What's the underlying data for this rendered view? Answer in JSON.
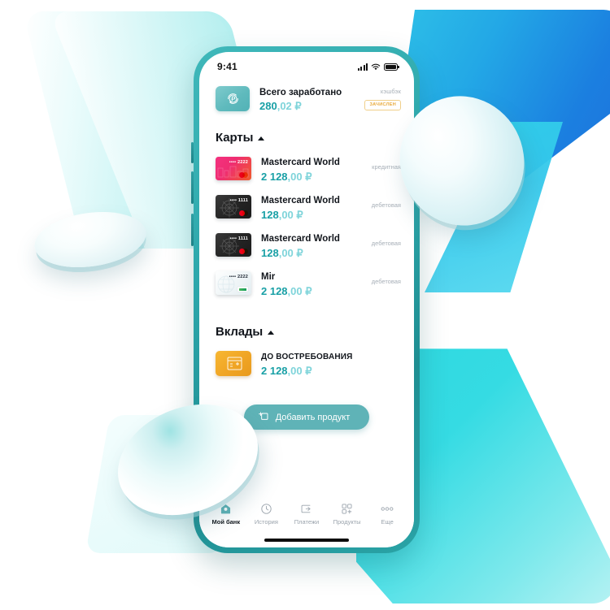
{
  "phone": {
    "status_bar": {
      "time": "9:41",
      "icons": [
        "signal-icon",
        "wifi-icon",
        "battery-icon"
      ]
    },
    "cashback": {
      "icon": "cashback-ruble-icon",
      "title": "Всего заработано",
      "amount_int": "280",
      "amount_dec": ",02",
      "currency": "₽",
      "label": "кэшбэк",
      "badge": "ЗАЧИСЛЕН"
    },
    "sections": [
      {
        "id": "cards",
        "title": "Карты",
        "collapse_icon": "caret-up-icon",
        "items": [
          {
            "art": "card-pink",
            "masked": "•••• 2222",
            "logo": "mastercard-icon",
            "name": "Mastercard World",
            "amount_int": "2 128",
            "amount_dec": ",00",
            "currency": "₽",
            "kind": "кредитная"
          },
          {
            "art": "card-dark",
            "masked": "•••• 1111",
            "logo": "mastercard-icon",
            "name": "Mastercard World",
            "amount_int": "128",
            "amount_dec": ",00",
            "currency": "₽",
            "kind": "дебетовая"
          },
          {
            "art": "card-dark",
            "masked": "•••• 1111",
            "logo": "mastercard-icon",
            "name": "Mastercard World",
            "amount_int": "128",
            "amount_dec": ",00",
            "currency": "₽",
            "kind": "дебетовая"
          },
          {
            "art": "card-mir",
            "masked": "•••• 2222",
            "logo": "mir-icon",
            "name": "Mir",
            "amount_int": "2 128",
            "amount_dec": ",00",
            "currency": "₽",
            "kind": "дебетовая"
          }
        ]
      },
      {
        "id": "deposits",
        "title": "Вклады",
        "collapse_icon": "caret-up-icon",
        "items": [
          {
            "art": "deposit-orange",
            "icon": "deposit-icon",
            "name": "ДО ВОСТРЕБОВАНИЯ",
            "amount_int": "2 128",
            "amount_dec": ",00",
            "currency": "₽",
            "kind": ""
          }
        ]
      }
    ],
    "add_button": {
      "icon": "add-product-icon",
      "label": "Добавить продукт"
    },
    "tabbar": [
      {
        "icon": "home-icon",
        "label": "Мой банк",
        "active": true
      },
      {
        "icon": "clock-icon",
        "label": "История",
        "active": false
      },
      {
        "icon": "payments-icon",
        "label": "Платежи",
        "active": false
      },
      {
        "icon": "grid-plus-icon",
        "label": "Продукты",
        "active": false
      },
      {
        "icon": "dots-icon",
        "label": "Еще",
        "active": false
      }
    ]
  },
  "decor": {
    "shapes": [
      "left-cyan-panel",
      "top-right-blue-wedge",
      "bottom-right-cyan-wedge",
      "bottom-left-mint-panel"
    ],
    "discs": [
      "floating-disc-right",
      "floating-disc-left",
      "floating-disc-bottom-left"
    ]
  },
  "colors": {
    "teal_frame": "#2da7ab",
    "accent": "#19a0a6",
    "accent_light": "#7fd4da",
    "button": "#5fb3b7",
    "badge": "#e8a93a",
    "blue": "#1b7fe0",
    "cyan": "#2ed8e0"
  }
}
